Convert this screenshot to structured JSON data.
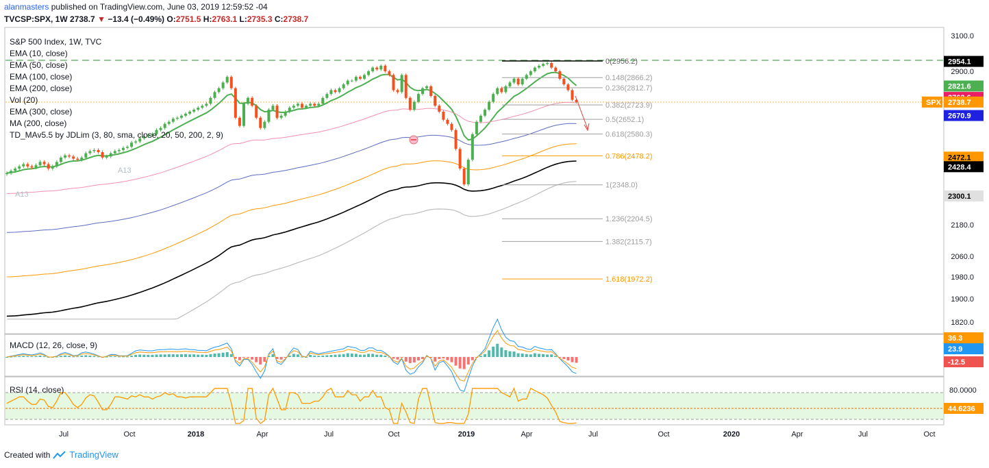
{
  "header": {
    "author": "alanmasters",
    "published_text": "published on TradingView.com, June 03, 2019 12:59:52 -04"
  },
  "ohlc_bar": {
    "symbol_line": "TVCSP:SPX, 1W",
    "last": "2738.7",
    "arrow": "▼",
    "change": "−13.4 (−0.49%)",
    "open_label": "O:",
    "open": "2751.5",
    "high_label": "H:",
    "high": "2763.1",
    "low_label": "L:",
    "low": "2735.3",
    "close_label": "C:",
    "close": "2738.7"
  },
  "legend": [
    "S&P 500 Index, 1W, TVC",
    "EMA (10, close)",
    "EMA (50, close)",
    "EMA (100, close)",
    "EMA (200, close)",
    "Vol (20)",
    "EMA (300, close)",
    "MA (200, close)",
    "TD_MAv5.5 by JDLim (3, 80, sma, close, 20, 50, 200, 2, 9)"
  ],
  "colors": {
    "up": "#4caf50",
    "down": "#f4511e",
    "ema10": "#4caf50",
    "ema50": "#f48fb1",
    "ema100": "#5c6bc0",
    "ema200": "#ff9800",
    "ema300": "#000000",
    "ma200": "#bdbdbd",
    "macd": "#2196f3",
    "signal": "#ff9800",
    "rsi": "#ff9800"
  },
  "footer": {
    "created_with": "Created with",
    "brand": "TradingView"
  },
  "chart_data": {
    "type": "candlestick",
    "symbol": "TVCSP:SPX",
    "timeframe": "1W",
    "price_axis_ticks": [
      "3100.0",
      "2900.0",
      "2180.0",
      "2060.0",
      "1980.0",
      "1900.0",
      "1820.0"
    ],
    "time_axis_ticks": [
      "Jul",
      "Oct",
      "2018",
      "Apr",
      "Jul",
      "Oct",
      "2019",
      "Apr",
      "Jul",
      "Oct",
      "2020",
      "Apr",
      "Jul",
      "Oct"
    ],
    "price_labels": [
      {
        "text": "2954.1",
        "value": 2954.1,
        "bg": "#000000",
        "fg": "#ffffff"
      },
      {
        "text": "2821.6",
        "value": 2821.6,
        "bg": "#4caf50",
        "fg": "#ffffff"
      },
      {
        "text": "2762.6",
        "value": 2762.6,
        "bg": "#e91e63",
        "fg": "#ffffff"
      },
      {
        "text": "2738.7",
        "value": 2738.7,
        "bg": "#ff9800",
        "fg": "#ffffff",
        "tag": "SPX"
      },
      {
        "text": "2670.9",
        "value": 2670.9,
        "bg": "#1e22e0",
        "fg": "#ffffff"
      },
      {
        "text": "2472.1",
        "value": 2472.1,
        "bg": "#ff9800",
        "fg": "#000000"
      },
      {
        "text": "2428.4",
        "value": 2428.4,
        "bg": "#000000",
        "fg": "#ffffff"
      },
      {
        "text": "2300.1",
        "value": 2300.1,
        "bg": "#e0e0e0",
        "fg": "#000000"
      }
    ],
    "fib_levels": [
      {
        "label": "0(2956.2)",
        "value": 2956.2,
        "color": "#000000"
      },
      {
        "label": "0.148(2866.2)",
        "value": 2866.2,
        "color": "#9e9e9e"
      },
      {
        "label": "0.236(2812.7)",
        "value": 2812.7,
        "color": "#9e9e9e"
      },
      {
        "label": "0.382(2723.9)",
        "value": 2723.9,
        "color": "#9e9e9e"
      },
      {
        "label": "0.5(2652.1)",
        "value": 2652.1,
        "color": "#9e9e9e"
      },
      {
        "label": "0.618(2580.3)",
        "value": 2580.3,
        "color": "#9e9e9e"
      },
      {
        "label": "0.786(2478.2)",
        "value": 2478.2,
        "color": "#ff9800"
      },
      {
        "label": "1(2348.0)",
        "value": 2348.0,
        "color": "#9e9e9e"
      },
      {
        "label": "1.236(2204.5)",
        "value": 2204.5,
        "color": "#9e9e9e"
      },
      {
        "label": "1.382(2115.7)",
        "value": 2115.7,
        "color": "#9e9e9e"
      },
      {
        "label": "1.618(1972.2)",
        "value": 1972.2,
        "color": "#ff9800"
      }
    ],
    "resistance_line": 2954.1,
    "annotations": [
      "A13",
      "A13"
    ],
    "candles": {
      "start_week": 0,
      "closes": [
        2400,
        2410,
        2420,
        2430,
        2440,
        2430,
        2425,
        2435,
        2450,
        2440,
        2420,
        2430,
        2450,
        2470,
        2480,
        2475,
        2465,
        2460,
        2470,
        2490,
        2500,
        2505,
        2495,
        2470,
        2475,
        2490,
        2500,
        2505,
        2515,
        2520,
        2540,
        2545,
        2560,
        2570,
        2575,
        2580,
        2600,
        2610,
        2630,
        2640,
        2655,
        2660,
        2670,
        2680,
        2690,
        2700,
        2710,
        2720,
        2730,
        2760,
        2790,
        2810,
        2840,
        2870,
        2810,
        2660,
        2620,
        2730,
        2760,
        2720,
        2660,
        2610,
        2640,
        2700,
        2720,
        2660,
        2670,
        2690,
        2710,
        2720,
        2730,
        2710,
        2720,
        2730,
        2720,
        2730,
        2760,
        2780,
        2800,
        2790,
        2810,
        2830,
        2850,
        2850,
        2870,
        2860,
        2880,
        2900,
        2920,
        2910,
        2930,
        2900,
        2880,
        2800,
        2790,
        2880,
        2760,
        2700,
        2740,
        2780,
        2810,
        2820,
        2770,
        2720,
        2690,
        2650,
        2630,
        2600,
        2510,
        2420,
        2350,
        2460,
        2580,
        2640,
        2670,
        2700,
        2740,
        2780,
        2810,
        2790,
        2820,
        2840,
        2860,
        2830,
        2860,
        2880,
        2900,
        2920,
        2930,
        2940,
        2945,
        2920,
        2900,
        2860,
        2830,
        2800,
        2750,
        2738.7
      ]
    },
    "macd": {
      "title": "MACD (12, 26, close, 9)",
      "labels": [
        {
          "text": "36.3",
          "value": 36.3,
          "bg": "#ff9800"
        },
        {
          "text": "23.9",
          "value": 23.9,
          "bg": "#2196f3"
        },
        {
          "text": "-12.5",
          "value": -12.5,
          "bg": "#ef5350"
        }
      ]
    },
    "rsi": {
      "title": "RSI (14, close)",
      "overbought": 80.0,
      "labels": [
        {
          "text": "80.0000",
          "value": 80.0
        },
        {
          "text": "44.6236",
          "value": 44.6236,
          "bg": "#ff9800"
        }
      ]
    }
  }
}
